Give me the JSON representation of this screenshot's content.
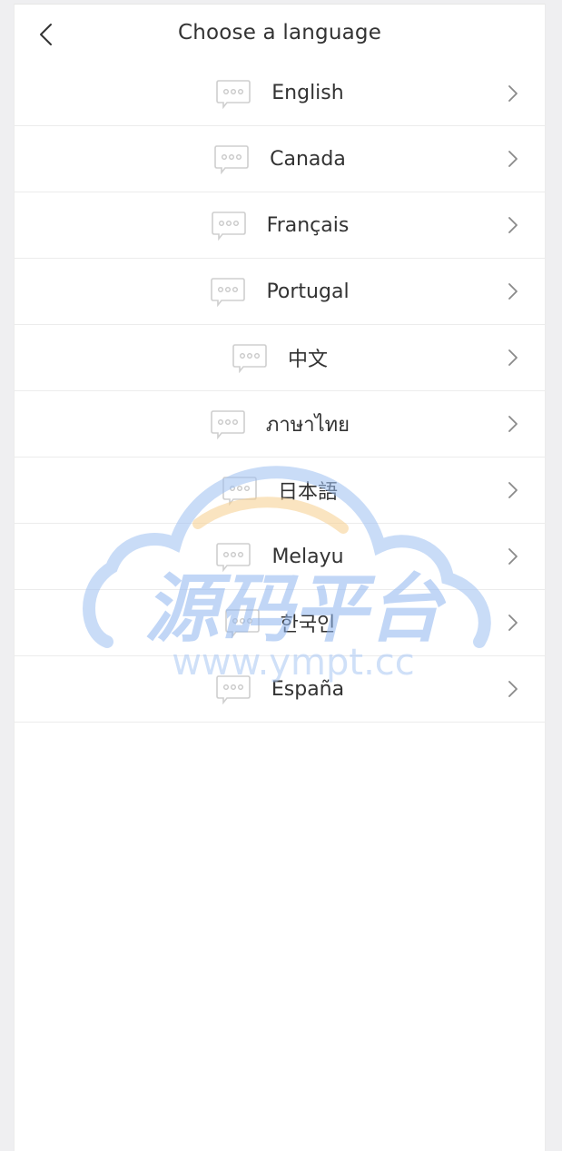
{
  "header": {
    "title": "Choose a language"
  },
  "languages": [
    {
      "label": "English"
    },
    {
      "label": "Canada"
    },
    {
      "label": "Français"
    },
    {
      "label": "Portugal"
    },
    {
      "label": "中文"
    },
    {
      "label": "ภาษาไทย"
    },
    {
      "label": "日本語"
    },
    {
      "label": "Melayu"
    },
    {
      "label": "한국인"
    },
    {
      "label": "España"
    }
  ],
  "watermark": {
    "main_text": "源码平台",
    "url_text": "www.ympt.cc"
  },
  "colors": {
    "background": "#efeff1",
    "panel": "#ffffff",
    "text": "#333333",
    "divider": "#ececec",
    "icon": "#c8c8c8",
    "watermark_blue": "#9ec0f2",
    "watermark_orange": "#f7cf8e"
  }
}
